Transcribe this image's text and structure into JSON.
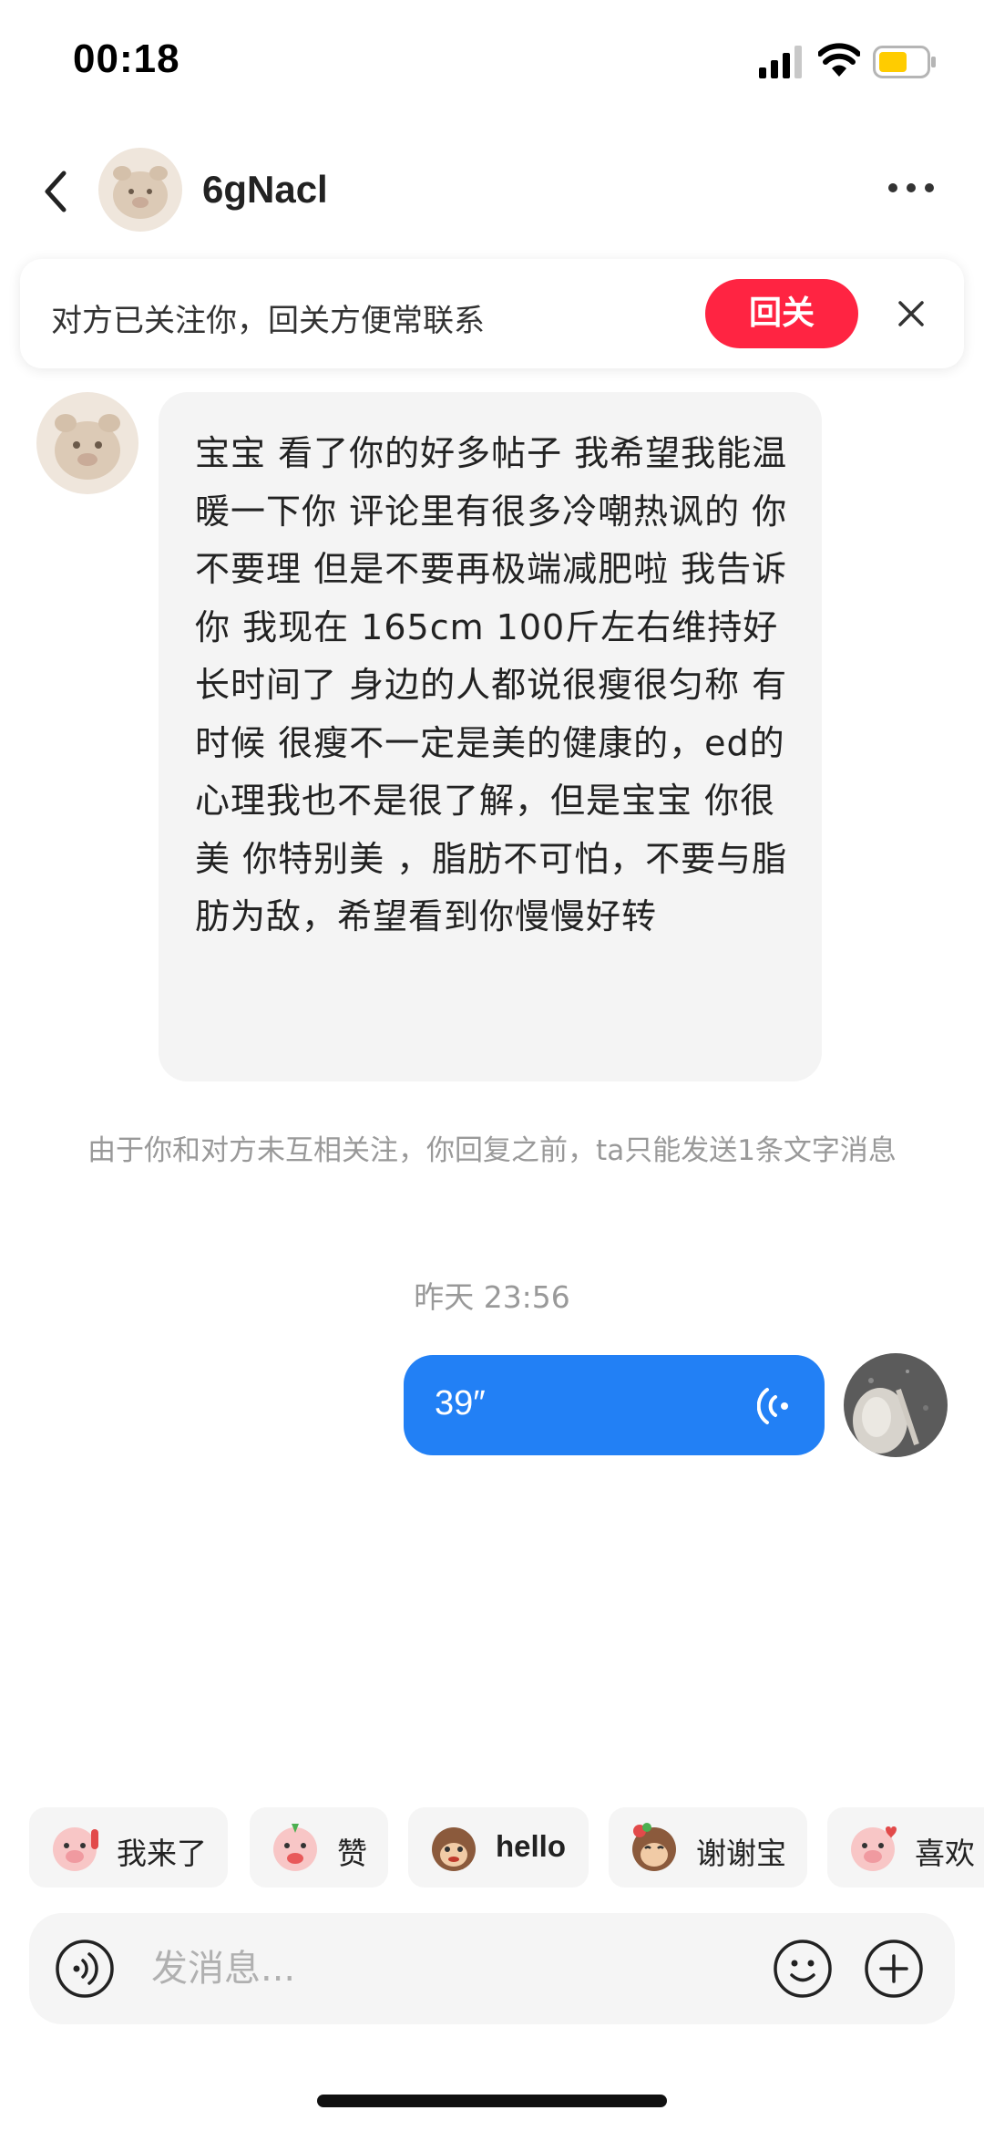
{
  "status_bar": {
    "time": "00:18",
    "signal_icon": "cellular-signal-icon",
    "wifi_icon": "wifi-icon",
    "battery_icon": "battery-icon",
    "battery_color": "#ffcc00"
  },
  "header": {
    "back_icon": "chevron-left-icon",
    "title": "6gNacl",
    "more_icon": "ellipsis-icon"
  },
  "follow_banner": {
    "text": "对方已关注你，回关方便常联系",
    "button_label": "回关",
    "button_color": "#ff2442",
    "close_icon": "close-icon"
  },
  "messages": {
    "incoming": {
      "text": "宝宝 看了你的好多帖子 我希望我能温暖一下你 评论里有很多冷嘲热讽的 你不要理 但是不要再极端减肥啦 我告诉你 我现在 165cm 100斤左右维持好长时间了 身边的人都说很瘦很匀称 有时候 很瘦不一定是美的健康的，ed的心理我也不是很了解，但是宝宝 你很美 你特别美 ，脂肪不可怕，不要与脂肪为敌，希望看到你慢慢好转"
    },
    "system_notice": "由于你和对方未互相关注，你回复之前，ta只能发送1条文字消息",
    "timestamp": "昨天 23:56",
    "outgoing_voice": {
      "duration": "39″",
      "bubble_color": "#2280f5",
      "wave_icon": "voice-wave-icon"
    }
  },
  "quick_replies": [
    {
      "label": "我来了",
      "icon": "pig-wave-emoji-icon"
    },
    {
      "label": "赞",
      "icon": "pig-thumbs-up-emoji-icon"
    },
    {
      "label": "hello",
      "icon": "monkey-hello-emoji-icon"
    },
    {
      "label": "谢谢宝",
      "icon": "monkey-thanks-emoji-icon"
    },
    {
      "label": "喜欢",
      "icon": "pig-heart-emoji-icon"
    }
  ],
  "input_bar": {
    "voice_icon": "voice-input-icon",
    "placeholder": "发消息...",
    "emoji_icon": "smiley-icon",
    "plus_icon": "plus-circle-icon"
  }
}
